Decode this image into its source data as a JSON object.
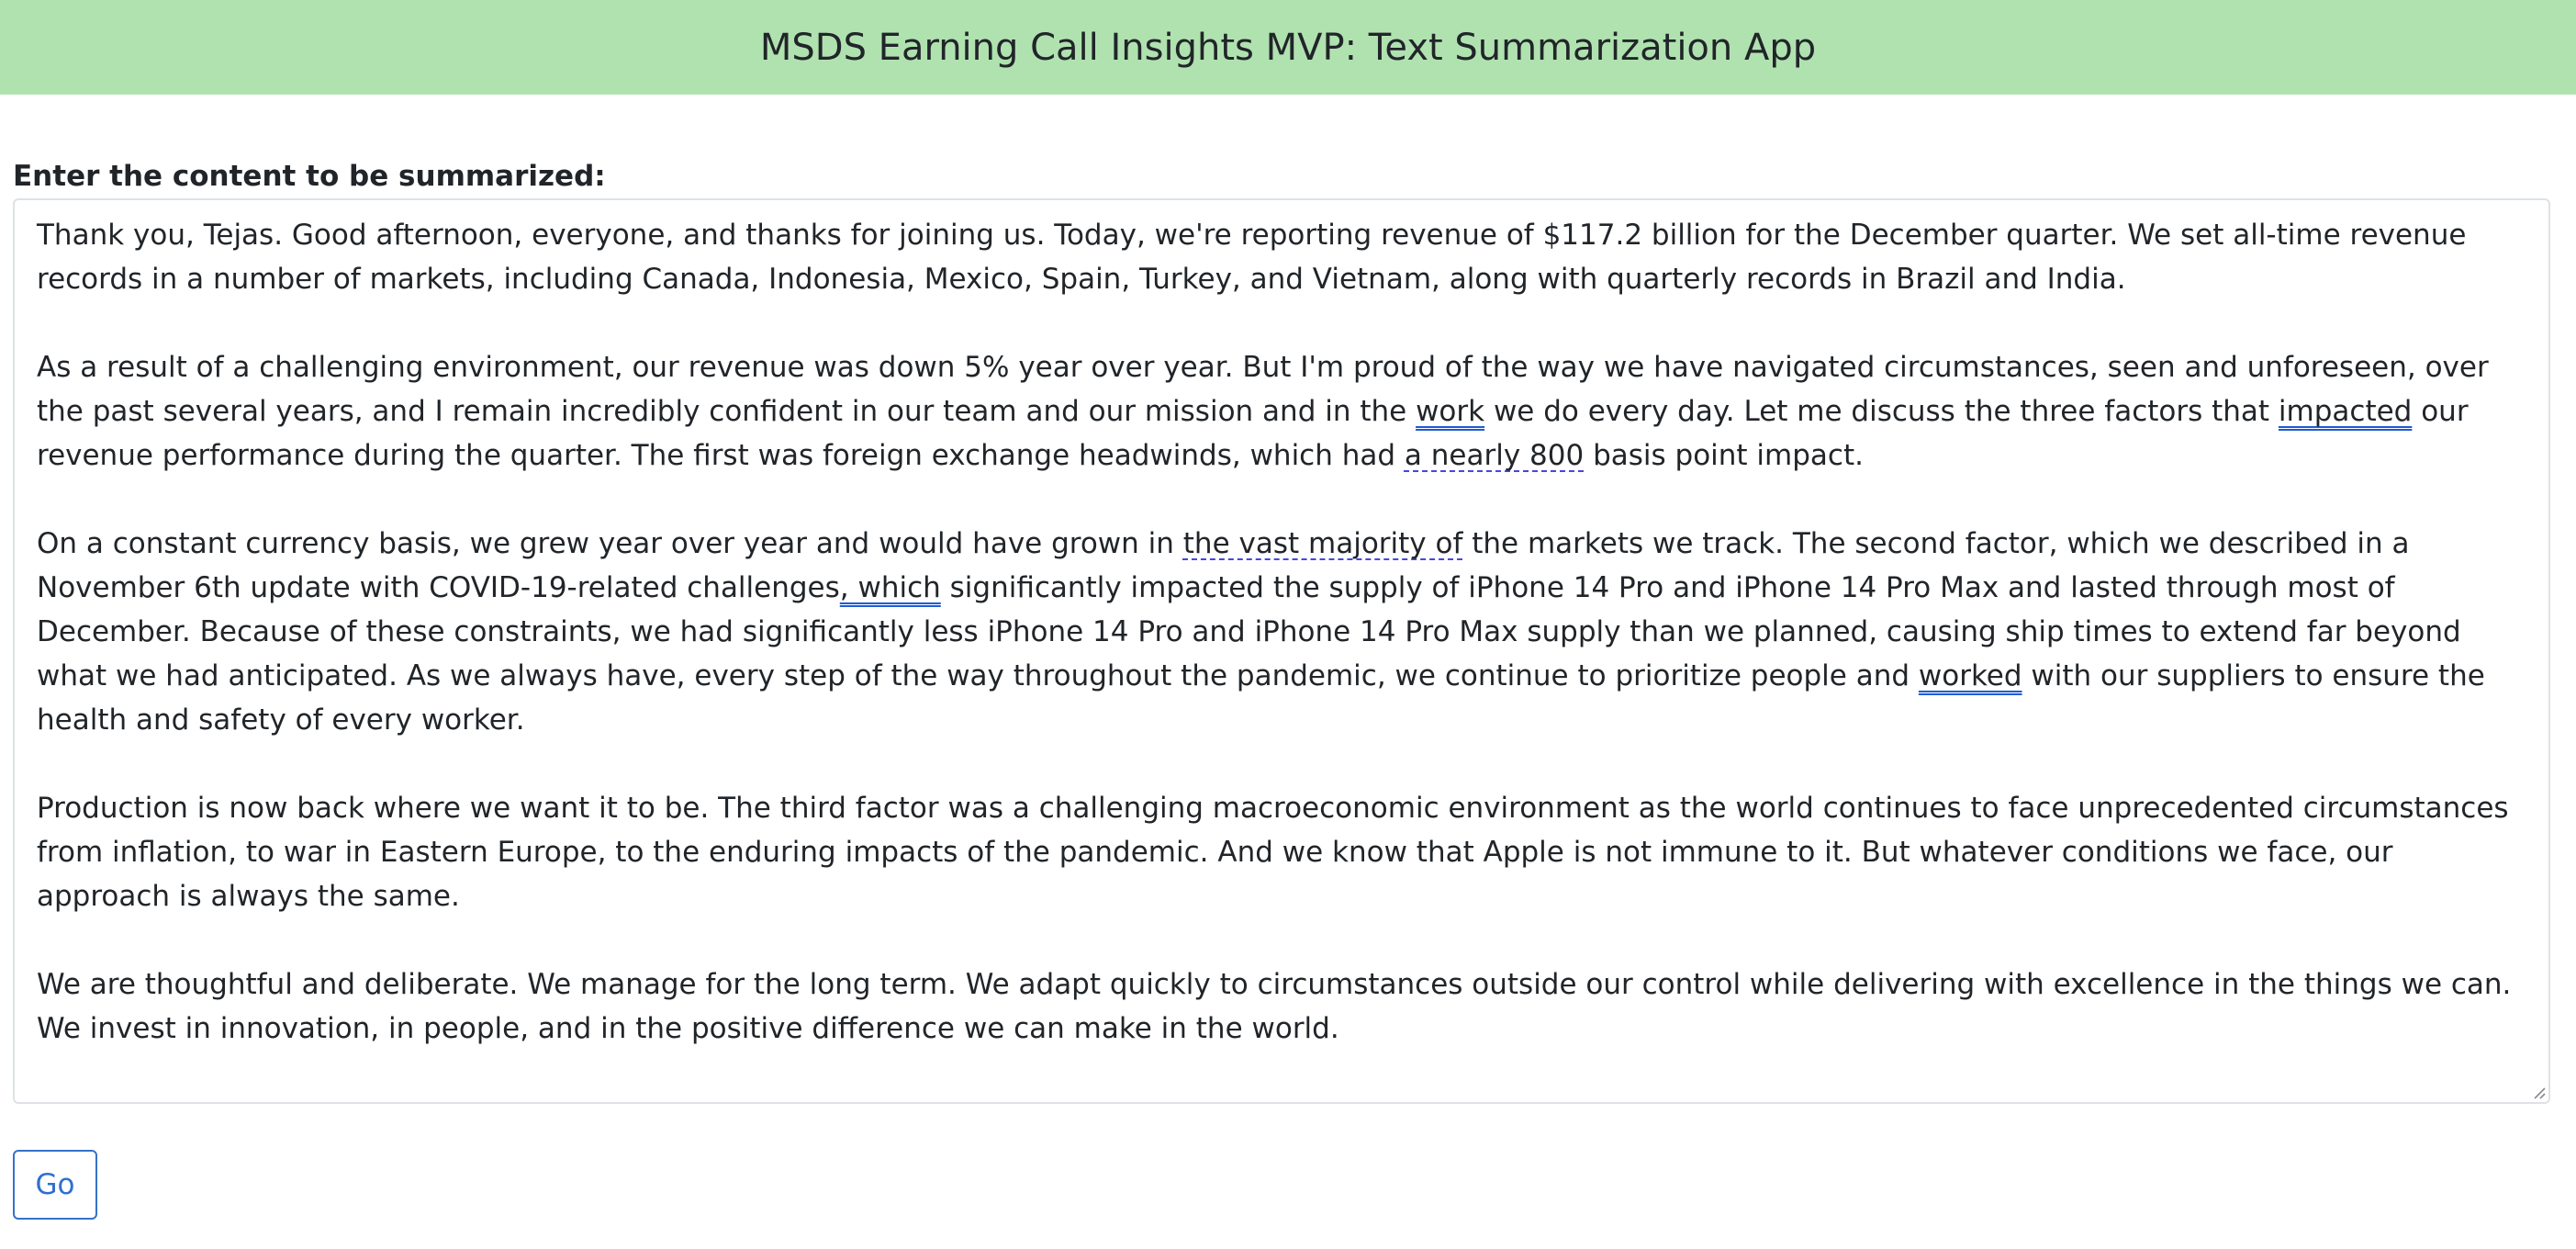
{
  "app": {
    "title": "MSDS Earning Call Insights MVP: Text Summarization App"
  },
  "form": {
    "label": "Enter the content to be summarized:",
    "submit_label": "Go"
  },
  "content": {
    "p1": "Thank you, Tejas. Good afternoon, everyone, and thanks for joining us. Today, we're reporting revenue of $117.2 billion for the December quarter. We set all-time revenue records in a number of markets, including Canada, Indonesia, Mexico, Spain, Turkey, and Vietnam, along with quarterly records in Brazil and India.",
    "p2": {
      "a": "As a result of a challenging environment, our revenue was down 5% year over year. But I'm proud of the way we have navigated circumstances, seen and unforeseen, over the past several years, and I remain incredibly confident in our team and our mission and in the ",
      "b": "work",
      "c": " we do every day. Let me discuss the three factors that ",
      "d": "impacted",
      "e": " our revenue performance during the quarter. The first was foreign exchange headwinds, which had ",
      "f": "a nearly 800",
      "g": " basis point impact."
    },
    "p3": {
      "a": "On a constant currency basis, we grew year over year and would have grown in ",
      "b": "the vast majority of",
      "c": " the markets we track. The second factor, which we described in a November 6th update with COVID-19-related challenges",
      "d": ", which",
      "e": " significantly impacted the supply of iPhone 14 Pro and iPhone 14 Pro Max and lasted through most of December. Because of these constraints, we had significantly less iPhone 14 Pro and iPhone 14 Pro Max supply than we planned, causing ship times to extend far beyond what we had anticipated. As we always have, every step of the way throughout the pandemic, we continue to prioritize people and ",
      "f": "worked",
      "g": " with our suppliers to ensure the health and safety of every worker."
    },
    "p4": "Production is now back where we want it to be. The third factor was a challenging macroeconomic environment as the world continues to face unprecedented circumstances from inflation, to war in Eastern Europe, to the enduring impacts of the pandemic. And we know that Apple is not immune to it. But whatever conditions we face, our approach is always the same.",
    "p5": "We are thoughtful and deliberate. We manage for the long term. We adapt quickly to circumstances outside our control while delivering with excellence in the things we can. We invest in innovation, in people, and in the positive difference we can make in the world."
  },
  "colors": {
    "header_bg": "#b0e2b0",
    "button_border": "#3572c9",
    "button_text": "#2f6fd0"
  }
}
